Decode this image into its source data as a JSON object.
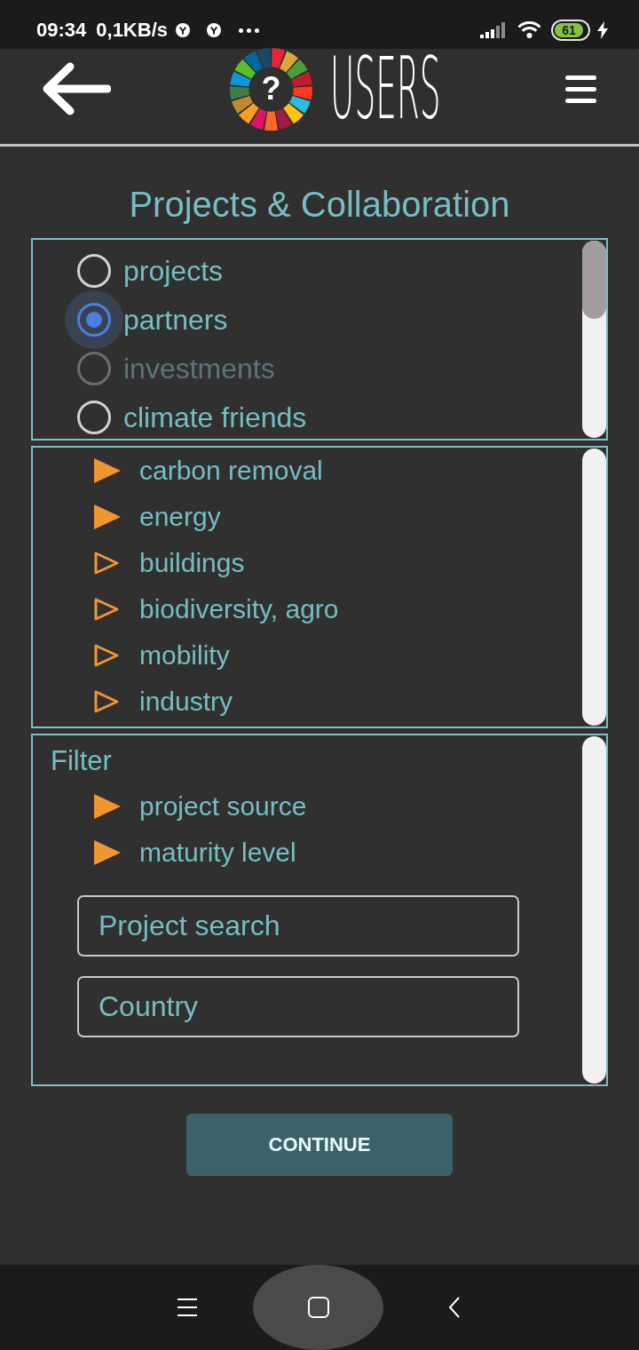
{
  "status_bar": {
    "time": "09:34",
    "net_speed": "0,1KB/s",
    "battery": "61"
  },
  "header": {
    "logo_mark": "?",
    "title": "USERS"
  },
  "page_title": "Projects & Collaboration",
  "view_options": [
    {
      "label": "projects",
      "selected": false,
      "disabled": false
    },
    {
      "label": "partners",
      "selected": true,
      "disabled": false
    },
    {
      "label": "investments",
      "selected": false,
      "disabled": true
    },
    {
      "label": "climate friends",
      "selected": false,
      "disabled": false
    }
  ],
  "sectors": [
    {
      "label": "carbon removal",
      "selected": true
    },
    {
      "label": "energy",
      "selected": true
    },
    {
      "label": "buildings",
      "selected": false
    },
    {
      "label": "biodiversity, agro",
      "selected": false
    },
    {
      "label": "mobility",
      "selected": false
    },
    {
      "label": "industry",
      "selected": false
    }
  ],
  "filter": {
    "title": "Filter",
    "items": [
      {
        "label": "project source",
        "selected": true
      },
      {
        "label": "maturity level",
        "selected": true
      }
    ],
    "fields": [
      {
        "placeholder": "Project search"
      },
      {
        "placeholder": "Country"
      }
    ]
  },
  "continue_button": {
    "label": "CONTINUE"
  }
}
